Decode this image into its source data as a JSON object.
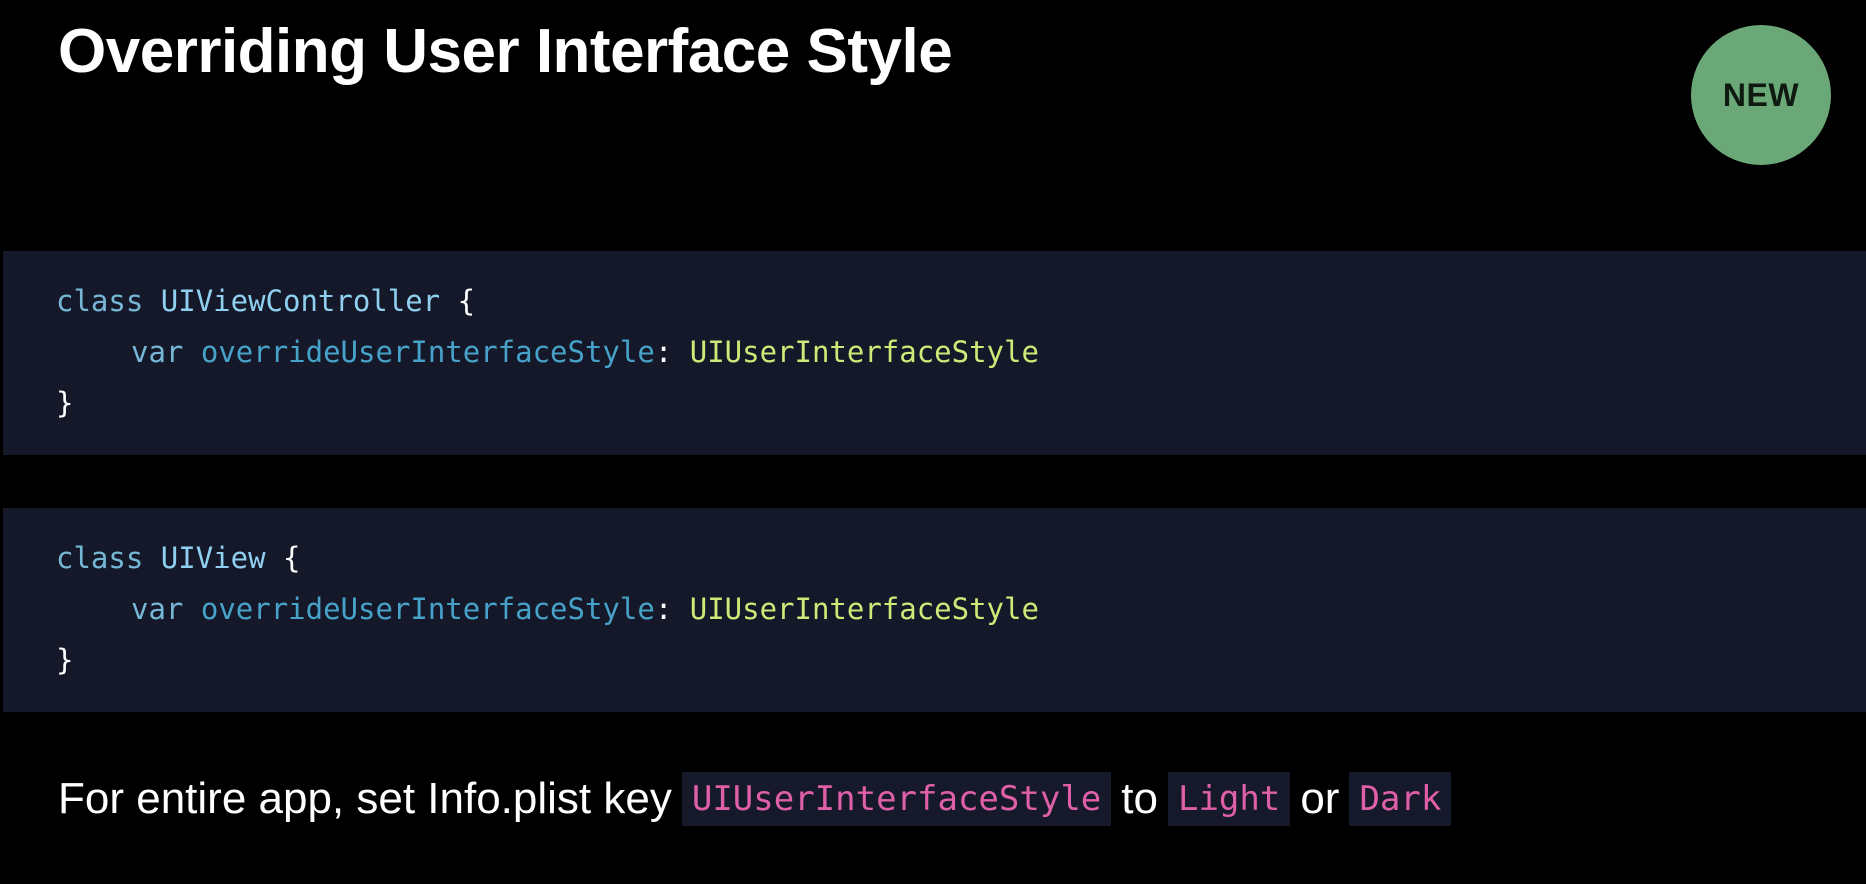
{
  "slide": {
    "title": "Overriding User Interface Style",
    "badge": "NEW"
  },
  "code_blocks": [
    {
      "line1": {
        "keyword": "class",
        "type": "UIViewController",
        "brace_open": "{"
      },
      "line2": {
        "keyword": "var",
        "property": "overrideUserInterfaceStyle",
        "colon": ":",
        "type": "UIUserInterfaceStyle"
      },
      "line3": {
        "brace_close": "}"
      }
    },
    {
      "line1": {
        "keyword": "class",
        "type": "UIView",
        "brace_open": "{"
      },
      "line2": {
        "keyword": "var",
        "property": "overrideUserInterfaceStyle",
        "colon": ":",
        "type": "UIUserInterfaceStyle"
      },
      "line3": {
        "brace_close": "}"
      }
    }
  ],
  "footer": {
    "text_before": "For entire app, set Info.plist key",
    "code_key": "UIUserInterfaceStyle",
    "text_to": "to",
    "code_light": "Light",
    "text_or": "or",
    "code_dark": "Dark"
  },
  "colors": {
    "background": "#000000",
    "code_background": "#141828",
    "badge": "#6aa878",
    "keyword": "#76b7d6",
    "property": "#47a2c9",
    "type_reference": "#d0e878",
    "inline_code": "#e060a8"
  }
}
